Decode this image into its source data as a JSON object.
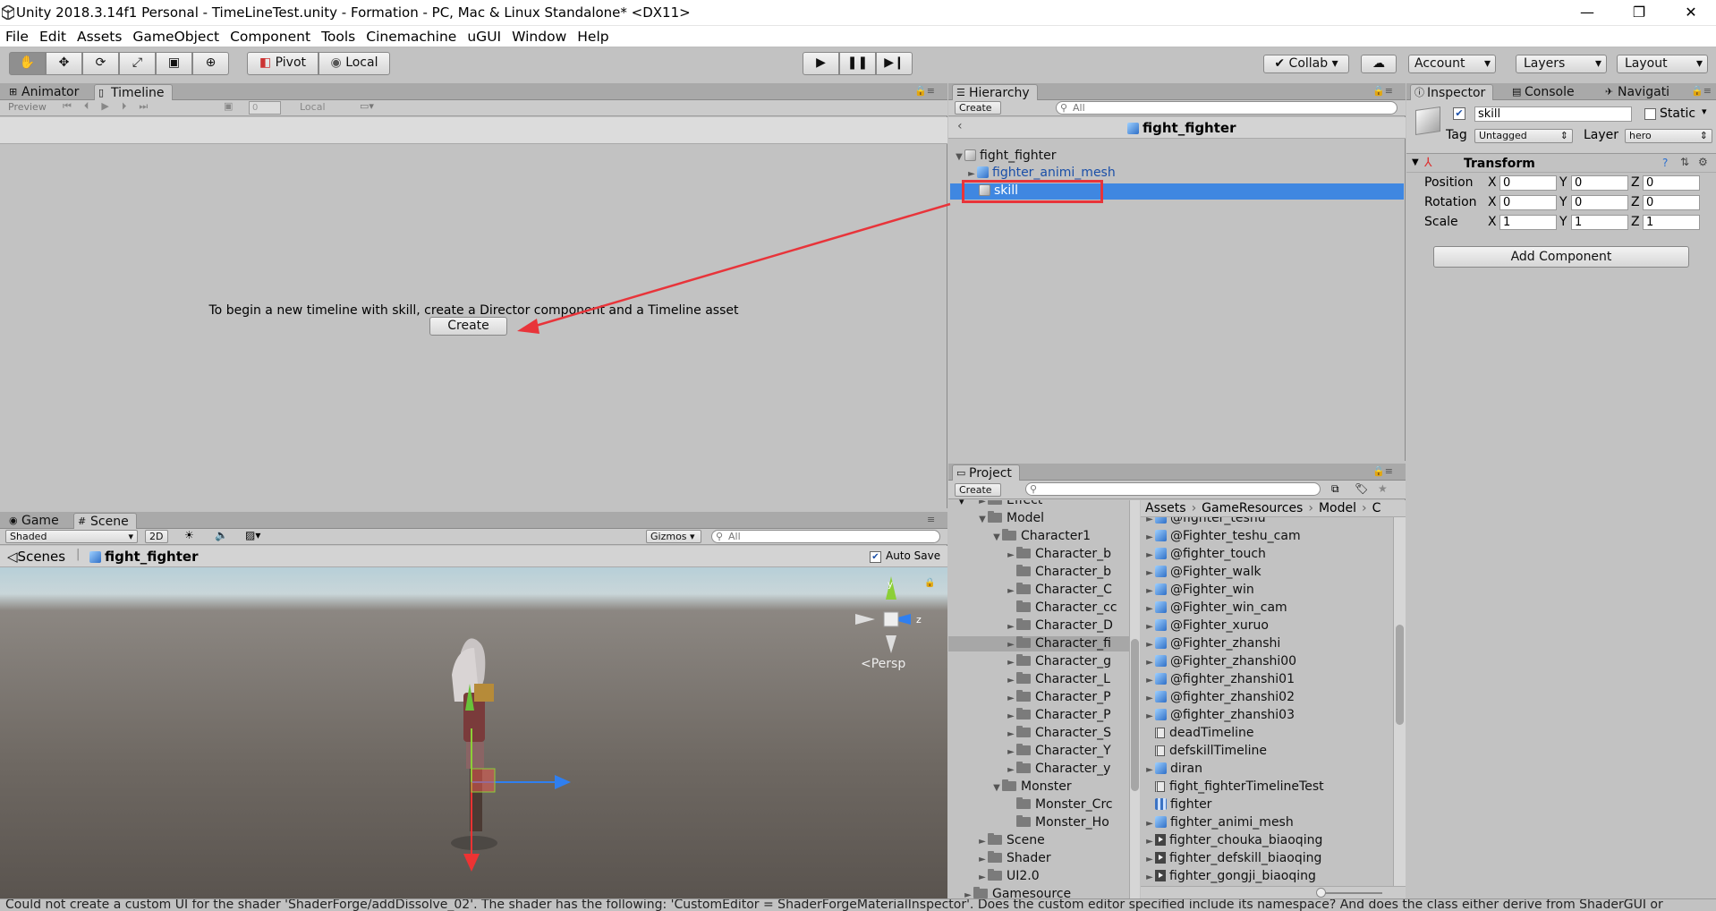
{
  "window": {
    "title": "Unity 2018.3.14f1 Personal - TimeLineTest.unity - Formation - PC, Mac & Linux Standalone* <DX11>",
    "minimize": "—",
    "maximize": "❐",
    "close": "✕"
  },
  "menu": [
    "File",
    "Edit",
    "Assets",
    "GameObject",
    "Component",
    "Tools",
    "Cinemachine",
    "uGUI",
    "Window",
    "Help"
  ],
  "toolbar": {
    "pivot": "Pivot",
    "local": "Local",
    "collab": "Collab",
    "account": "Account",
    "layers": "Layers",
    "layout": "Layout"
  },
  "timeline": {
    "tabs": [
      "Animator",
      "Timeline"
    ],
    "preview": "Preview",
    "frame": "0",
    "local": "Local",
    "message": "To begin a new timeline with skill, create a Director component and a Timeline asset",
    "create_label": "Create"
  },
  "hierarchy": {
    "tab": "Hierarchy",
    "create": "Create",
    "search_placeholder": "All",
    "scene_header": "fight_fighter",
    "items": [
      {
        "label": "fight_fighter"
      },
      {
        "label": "fighter_animi_mesh"
      },
      {
        "label": "skill",
        "selected": true
      }
    ]
  },
  "inspector": {
    "tabs": [
      "Inspector",
      "Console",
      "Navigati"
    ],
    "object_name": "skill",
    "static_label": "Static",
    "tag_label": "Tag",
    "tag_value": "Untagged",
    "layer_label": "Layer",
    "layer_value": "hero",
    "component": "Transform",
    "rows": [
      {
        "label": "Position",
        "x": "0",
        "y": "0",
        "z": "0"
      },
      {
        "label": "Rotation",
        "x": "0",
        "y": "0",
        "z": "0"
      },
      {
        "label": "Scale",
        "x": "1",
        "y": "1",
        "z": "1"
      }
    ],
    "axis": {
      "x": "X",
      "y": "Y",
      "z": "Z"
    },
    "add_component": "Add Component"
  },
  "scene": {
    "tabs": [
      "Game",
      "Scene"
    ],
    "shading": "Shaded",
    "mode_2d": "2D",
    "gizmos": "Gizmos",
    "search_placeholder": "All",
    "breadcrumb_root": "Scenes",
    "breadcrumb_object": "fight_fighter",
    "auto_save": "Auto Save",
    "persp": "<Persp",
    "gizmo_y": "y",
    "gizmo_z": "z"
  },
  "project": {
    "tab": "Project",
    "create": "Create",
    "tree": [
      {
        "label": "Effect",
        "depth": 1,
        "arrow": "►"
      },
      {
        "label": "Model",
        "depth": 1,
        "arrow": "▼"
      },
      {
        "label": "Character1",
        "depth": 2,
        "arrow": "▼"
      },
      {
        "label": "Character_b",
        "depth": 3,
        "arrow": "►"
      },
      {
        "label": "Character_b",
        "depth": 3,
        "arrow": ""
      },
      {
        "label": "Character_C",
        "depth": 3,
        "arrow": "►"
      },
      {
        "label": "Character_cc",
        "depth": 3,
        "arrow": ""
      },
      {
        "label": "Character_D",
        "depth": 3,
        "arrow": "►"
      },
      {
        "label": "Character_fi",
        "depth": 3,
        "arrow": "►",
        "selected": true
      },
      {
        "label": "Character_g",
        "depth": 3,
        "arrow": "►"
      },
      {
        "label": "Character_L",
        "depth": 3,
        "arrow": "►"
      },
      {
        "label": "Character_P",
        "depth": 3,
        "arrow": "►"
      },
      {
        "label": "Character_P",
        "depth": 3,
        "arrow": "►"
      },
      {
        "label": "Character_S",
        "depth": 3,
        "arrow": "►"
      },
      {
        "label": "Character_Y",
        "depth": 3,
        "arrow": "►"
      },
      {
        "label": "Character_y",
        "depth": 3,
        "arrow": "►"
      },
      {
        "label": "Monster",
        "depth": 2,
        "arrow": "▼"
      },
      {
        "label": "Monster_Crc",
        "depth": 3,
        "arrow": ""
      },
      {
        "label": "Monster_Ho",
        "depth": 3,
        "arrow": ""
      },
      {
        "label": "Scene",
        "depth": 1,
        "arrow": "►"
      },
      {
        "label": "Shader",
        "depth": 1,
        "arrow": "►"
      },
      {
        "label": "UI2.0",
        "depth": 1,
        "arrow": "►"
      },
      {
        "label": "Gamesource",
        "depth": 0,
        "arrow": "►"
      }
    ],
    "breadcrumb": [
      "Assets",
      "GameResources",
      "Model",
      "C"
    ],
    "assets": [
      {
        "label": "@fighter_teshu",
        "icon": "model"
      },
      {
        "label": "@Fighter_teshu_cam",
        "icon": "model"
      },
      {
        "label": "@fighter_touch",
        "icon": "model"
      },
      {
        "label": "@Fighter_walk",
        "icon": "model"
      },
      {
        "label": "@Fighter_win",
        "icon": "model"
      },
      {
        "label": "@Fighter_win_cam",
        "icon": "model"
      },
      {
        "label": "@Fighter_xuruo",
        "icon": "model"
      },
      {
        "label": "@Fighter_zhanshi",
        "icon": "model"
      },
      {
        "label": "@Fighter_zhanshi00",
        "icon": "model"
      },
      {
        "label": "@fighter_zhanshi01",
        "icon": "model"
      },
      {
        "label": "@fighter_zhanshi02",
        "icon": "model"
      },
      {
        "label": "@fighter_zhanshi03",
        "icon": "model"
      },
      {
        "label": "deadTimeline",
        "icon": "timeline"
      },
      {
        "label": "defskillTimeline",
        "icon": "timeline"
      },
      {
        "label": "diran",
        "icon": "model"
      },
      {
        "label": "fight_fighterTimelineTest",
        "icon": "timeline"
      },
      {
        "label": "fighter",
        "icon": "grid"
      },
      {
        "label": "fighter_animi_mesh",
        "icon": "model"
      },
      {
        "label": "fighter_chouka_biaoqing",
        "icon": "anim"
      },
      {
        "label": "fighter_defskill_biaoqing",
        "icon": "anim"
      },
      {
        "label": "fighter_gongji_biaoqing",
        "icon": "anim"
      }
    ]
  },
  "statusbar": {
    "message": "Could not create a custom UI for the shader 'ShaderForge/addDissolve_02'. The shader has the following: 'CustomEditor = ShaderForgeMaterialInspector'. Does the custom editor specified include its namespace? And does the class either derive from ShaderGUI or"
  },
  "colors": {
    "selection": "#3f87e1",
    "annotation_red": "#e8343a",
    "panel_bg": "#c2c2c2"
  }
}
